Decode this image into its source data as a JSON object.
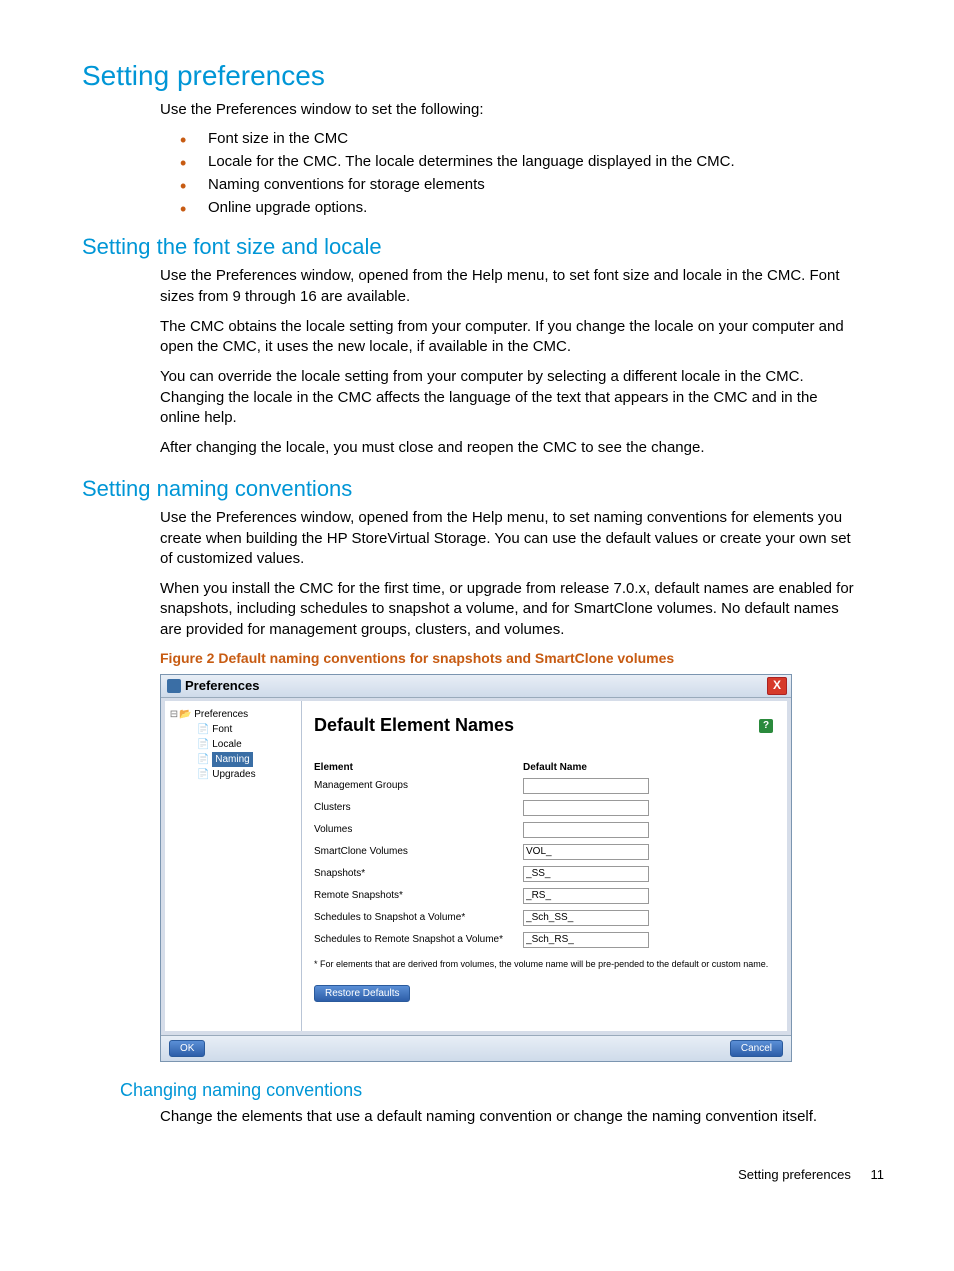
{
  "h1": "Setting preferences",
  "intro": "Use the Preferences window to set the following:",
  "bullets": [
    "Font size in the CMC",
    "Locale for the CMC. The locale determines the language displayed in the CMC.",
    "Naming conventions for storage elements",
    "Online upgrade options."
  ],
  "h2a": "Setting the font size and locale",
  "h2a_p1": "Use the Preferences window, opened from the Help menu, to set font size and locale in the CMC. Font sizes from 9 through 16 are available.",
  "h2a_p2": "The CMC obtains the locale setting from your computer. If you change the locale on your computer and open the CMC, it uses the new locale, if available in the CMC.",
  "h2a_p3": "You can override the locale setting from your computer by selecting a different locale in the CMC. Changing the locale in the CMC affects the language of the text that appears in the CMC and in the online help.",
  "h2a_p4": "After changing the locale, you must close and reopen the CMC to see the change.",
  "h2b": "Setting naming conventions",
  "h2b_p1": "Use the Preferences window, opened from the Help menu, to set naming conventions for elements you create when building the HP StoreVirtual Storage. You can use the default values or create your own set of customized values.",
  "h2b_p2": "When you install the CMC for the first time, or upgrade from release 7.0.x, default names are enabled for snapshots, including schedules to snapshot a volume, and for SmartClone volumes. No default names are provided for management groups, clusters, and volumes.",
  "figcap": "Figure 2 Default naming conventions for snapshots and SmartClone volumes",
  "dialog": {
    "title": "Preferences",
    "nav": {
      "root": "Preferences",
      "items": [
        "Font",
        "Locale",
        "Naming",
        "Upgrades"
      ],
      "selected": "Naming"
    },
    "panel_title": "Default Element Names",
    "table": {
      "col_element": "Element",
      "col_default": "Default Name",
      "rows": [
        {
          "label": "Management Groups",
          "value": ""
        },
        {
          "label": "Clusters",
          "value": ""
        },
        {
          "label": "Volumes",
          "value": ""
        },
        {
          "label": "SmartClone Volumes",
          "value": "VOL_"
        },
        {
          "label": "Snapshots*",
          "value": "_SS_"
        },
        {
          "label": "Remote Snapshots*",
          "value": "_RS_"
        },
        {
          "label": "Schedules to Snapshot a Volume*",
          "value": "_Sch_SS_"
        },
        {
          "label": "Schedules to Remote Snapshot a Volume*",
          "value": "_Sch_RS_"
        }
      ]
    },
    "footnote": "* For elements that are derived from volumes, the volume name will be pre-pended to the default or custom name.",
    "restore": "Restore Defaults",
    "ok": "OK",
    "cancel": "Cancel"
  },
  "h3": "Changing naming conventions",
  "h3_p1": "Change the elements that use a default naming convention or change the naming convention itself.",
  "footer_text": "Setting preferences",
  "footer_page": "11"
}
